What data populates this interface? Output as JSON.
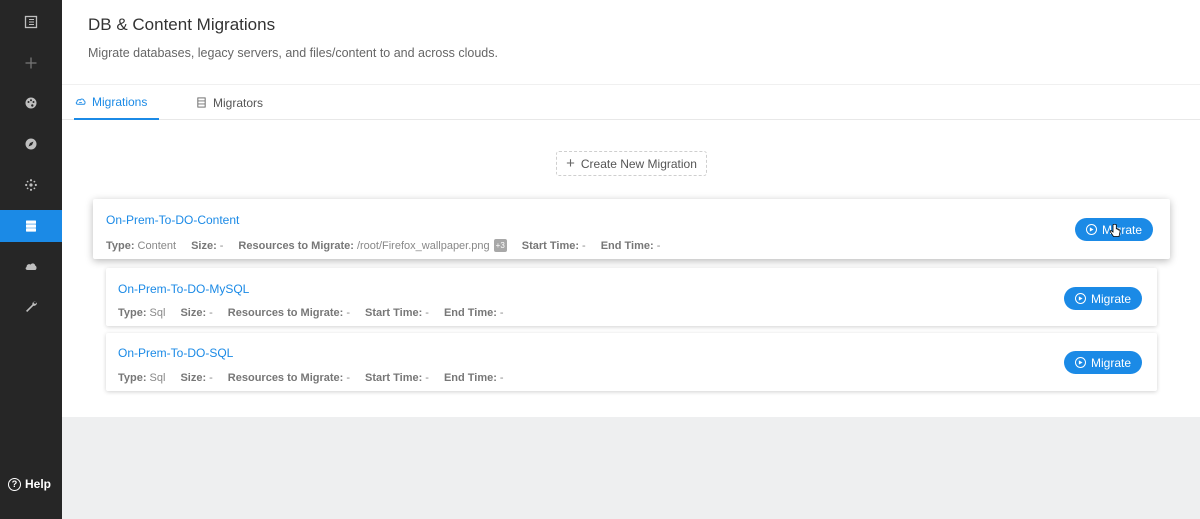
{
  "sidebar": {
    "icons": [
      "dashboard-icon",
      "add-icon",
      "palette-icon",
      "compass-icon",
      "cluster-icon",
      "database-icon",
      "cloud-icon",
      "wrench-icon"
    ],
    "active": "database-icon",
    "help_label": "Help",
    "help_symbol": "?"
  },
  "header": {
    "title": "DB & Content Migrations",
    "subtitle": "Migrate databases, legacy servers, and files/content to and across clouds."
  },
  "tabs": [
    {
      "label": "Migrations",
      "icon": "cloud-sync-icon",
      "active": true
    },
    {
      "label": "Migrators",
      "icon": "server-icon",
      "active": false
    }
  ],
  "create_button": {
    "symbol": "+",
    "label": "Create New Migration"
  },
  "migrations": [
    {
      "name": "On-Prem-To-DO-Content",
      "type_key": "Type:",
      "type": "Content",
      "size_key": "Size:",
      "size": "-",
      "resources_key": "Resources to Migrate:",
      "resources": "/root/Firefox_wallpaper.png",
      "resources_more": "+3",
      "start_key": "Start Time:",
      "start": "-",
      "end_key": "End Time:",
      "end": "-",
      "button": "Migrate"
    },
    {
      "name": "On-Prem-To-DO-MySQL",
      "type_key": "Type:",
      "type": "Sql",
      "size_key": "Size:",
      "size": "-",
      "resources_key": "Resources to Migrate:",
      "resources": "-",
      "start_key": "Start Time:",
      "start": "-",
      "end_key": "End Time:",
      "end": "-",
      "button": "Migrate"
    },
    {
      "name": "On-Prem-To-DO-SQL",
      "type_key": "Type:",
      "type": "Sql",
      "size_key": "Size:",
      "size": "-",
      "resources_key": "Resources to Migrate:",
      "resources": "-",
      "start_key": "Start Time:",
      "start": "-",
      "end_key": "End Time:",
      "end": "-",
      "button": "Migrate"
    }
  ],
  "colors": {
    "accent": "#1b8ae6",
    "sidebar": "#262626"
  }
}
